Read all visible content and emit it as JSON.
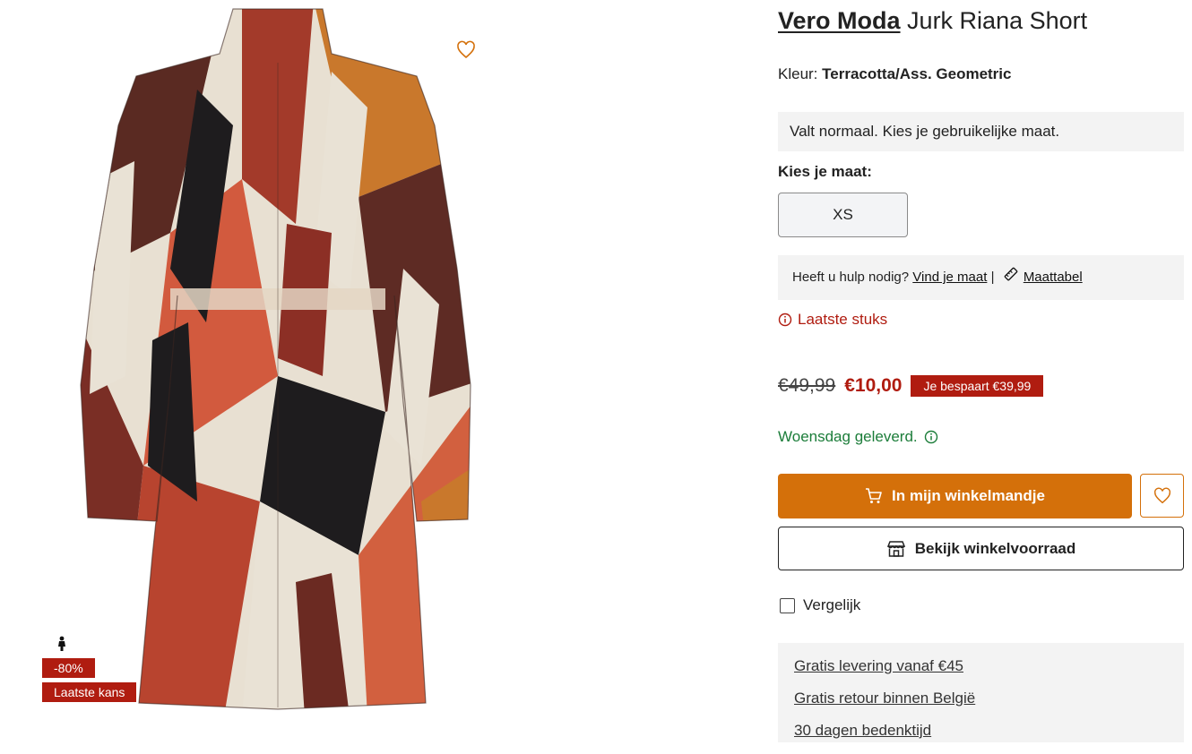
{
  "product": {
    "brand": "Vero Moda",
    "name": "Jurk Riana Short",
    "color_label": "Kleur:",
    "color_value": "Terracotta/Ass. Geometric",
    "fit_note": "Valt normaal. Kies je gebruikelijke maat.",
    "size_label": "Kies je maat:",
    "sizes": [
      "XS"
    ]
  },
  "help": {
    "text": "Heeft u hulp nodig?",
    "find_size": "Vind je maat",
    "separator": "|",
    "size_chart": "Maattabel"
  },
  "stock": {
    "text": "Laatste stuks",
    "icon": "info-circle-icon"
  },
  "price": {
    "old": "€49,99",
    "new": "€10,00",
    "saving": "Je bespaart €39,99"
  },
  "delivery": {
    "text": "Woensdag geleverd.",
    "icon": "info-circle-icon"
  },
  "actions": {
    "cart": "In mijn winkelmandje",
    "store": "Bekijk winkelvoorraad",
    "compare": "Vergelijk"
  },
  "badges": {
    "discount": "-80%",
    "last_chance": "Laatste kans"
  },
  "usp": [
    "Gratis levering vanaf €45",
    "Gratis retour binnen België",
    "30 dagen bedenktijd"
  ],
  "colors": {
    "accent": "#d4700a",
    "sale": "#b01c10",
    "delivery": "#1c7d3a",
    "panel_bg": "#f3f3f3"
  }
}
